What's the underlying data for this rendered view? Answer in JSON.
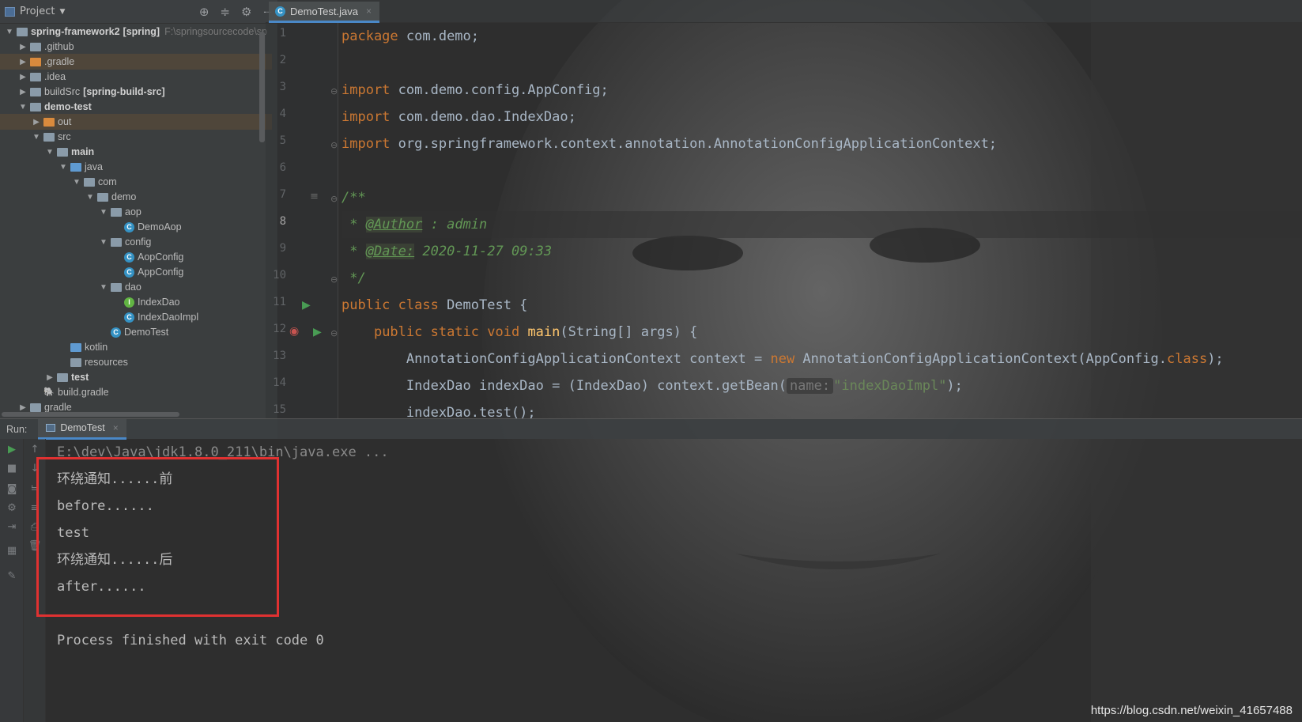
{
  "project": {
    "title": "Project",
    "tree": [
      {
        "label": "spring-framework2",
        "extra": "[spring]",
        "path": "F:\\springsourcecode\\sp",
        "icon": "module-folder-icon",
        "expanded": true
      },
      {
        "label": ".github",
        "icon": "folder-icon"
      },
      {
        "label": ".gradle",
        "icon": "folder-icon"
      },
      {
        "label": ".idea",
        "icon": "folder-icon"
      },
      {
        "label": "buildSrc",
        "extra": "[spring-build-src]",
        "icon": "module-folder-icon"
      },
      {
        "label": "demo-test",
        "icon": "module-folder-icon",
        "expanded": true
      },
      {
        "label": "out",
        "icon": "folder-icon"
      },
      {
        "label": "src",
        "icon": "folder-icon",
        "expanded": true
      },
      {
        "label": "main",
        "icon": "folder-icon",
        "expanded": true
      },
      {
        "label": "java",
        "icon": "source-folder-icon",
        "expanded": true
      },
      {
        "label": "com",
        "icon": "package-icon",
        "expanded": true
      },
      {
        "label": "demo",
        "icon": "package-icon",
        "expanded": true
      },
      {
        "label": "aop",
        "icon": "package-icon",
        "expanded": true
      },
      {
        "label": "DemoAop",
        "icon": "class-icon"
      },
      {
        "label": "config",
        "icon": "package-icon",
        "expanded": true
      },
      {
        "label": "AopConfig",
        "icon": "class-icon"
      },
      {
        "label": "AppConfig",
        "icon": "class-icon"
      },
      {
        "label": "dao",
        "icon": "package-icon",
        "expanded": true
      },
      {
        "label": "IndexDao",
        "icon": "interface-icon"
      },
      {
        "label": "IndexDaoImpl",
        "icon": "class-icon"
      },
      {
        "label": "DemoTest",
        "icon": "class-icon"
      },
      {
        "label": "kotlin",
        "icon": "source-folder-icon"
      },
      {
        "label": "resources",
        "icon": "resources-folder-icon"
      },
      {
        "label": "test",
        "icon": "folder-icon"
      },
      {
        "label": "build.gradle",
        "icon": "gradle-icon"
      },
      {
        "label": "gradle",
        "icon": "folder-icon"
      }
    ]
  },
  "editor": {
    "tab": "DemoTest.java",
    "current_line": 8,
    "line_numbers": [
      "1",
      "2",
      "3",
      "4",
      "5",
      "6",
      "7",
      "8",
      "9",
      "10",
      "11",
      "12",
      "13",
      "14",
      "15"
    ],
    "code": {
      "l1_kw": "package",
      "l1_rest": " com.demo;",
      "l3_kw": "import",
      "l3_rest": " com.demo.config.AppConfig;",
      "l4_kw": "import",
      "l4_rest": " com.demo.dao.IndexDao;",
      "l5_kw": "import",
      "l5_rest": " org.springframework.context.annotation.AnnotationConfigApplicationContext;",
      "l7": "/**",
      "l8_star": " * ",
      "l8_tag": "@Author",
      "l8_rest": " : admin",
      "l9_star": " * ",
      "l9_tag": "@Date:",
      "l9_rest": " 2020-11-27 09:33",
      "l10": " */",
      "l11_kw": "public class",
      "l11_rest": " DemoTest {",
      "l12_ind": "    ",
      "l12_kw": "public static void",
      "l12_sp": " ",
      "l12_fn": "main",
      "l12_rest": "(String[] args) {",
      "l13_ind": "        ",
      "l13_a": "AnnotationConfigApplicationContext context = ",
      "l13_kw": "new",
      "l13_b": " AnnotationConfigApplicationContext(AppConfig.",
      "l13_kw2": "class",
      "l13_c": ");",
      "l14_ind": "        ",
      "l14_a": "IndexDao indexDao = (IndexDao) context.getBean(",
      "l14_hint": "name:",
      "l14_str": "\"indexDaoImpl\"",
      "l14_c": ");",
      "l15": "        indexDao.test();"
    }
  },
  "run": {
    "label": "Run:",
    "tab": "DemoTest",
    "output": [
      "E:\\dev\\Java\\jdk1.8.0_211\\bin\\java.exe ...",
      "环绕通知......前",
      "before......",
      "test",
      "环绕通知......后",
      "after......",
      "",
      "Process finished with exit code 0"
    ]
  },
  "watermark": "https://blog.csdn.net/weixin_41657488",
  "colors": {
    "keyword": "#cc7832",
    "comment": "#629755",
    "string": "#6a8759",
    "method": "#ffc66d",
    "highlight_box": "#e03131",
    "accent_tab": "#4a88c7"
  }
}
